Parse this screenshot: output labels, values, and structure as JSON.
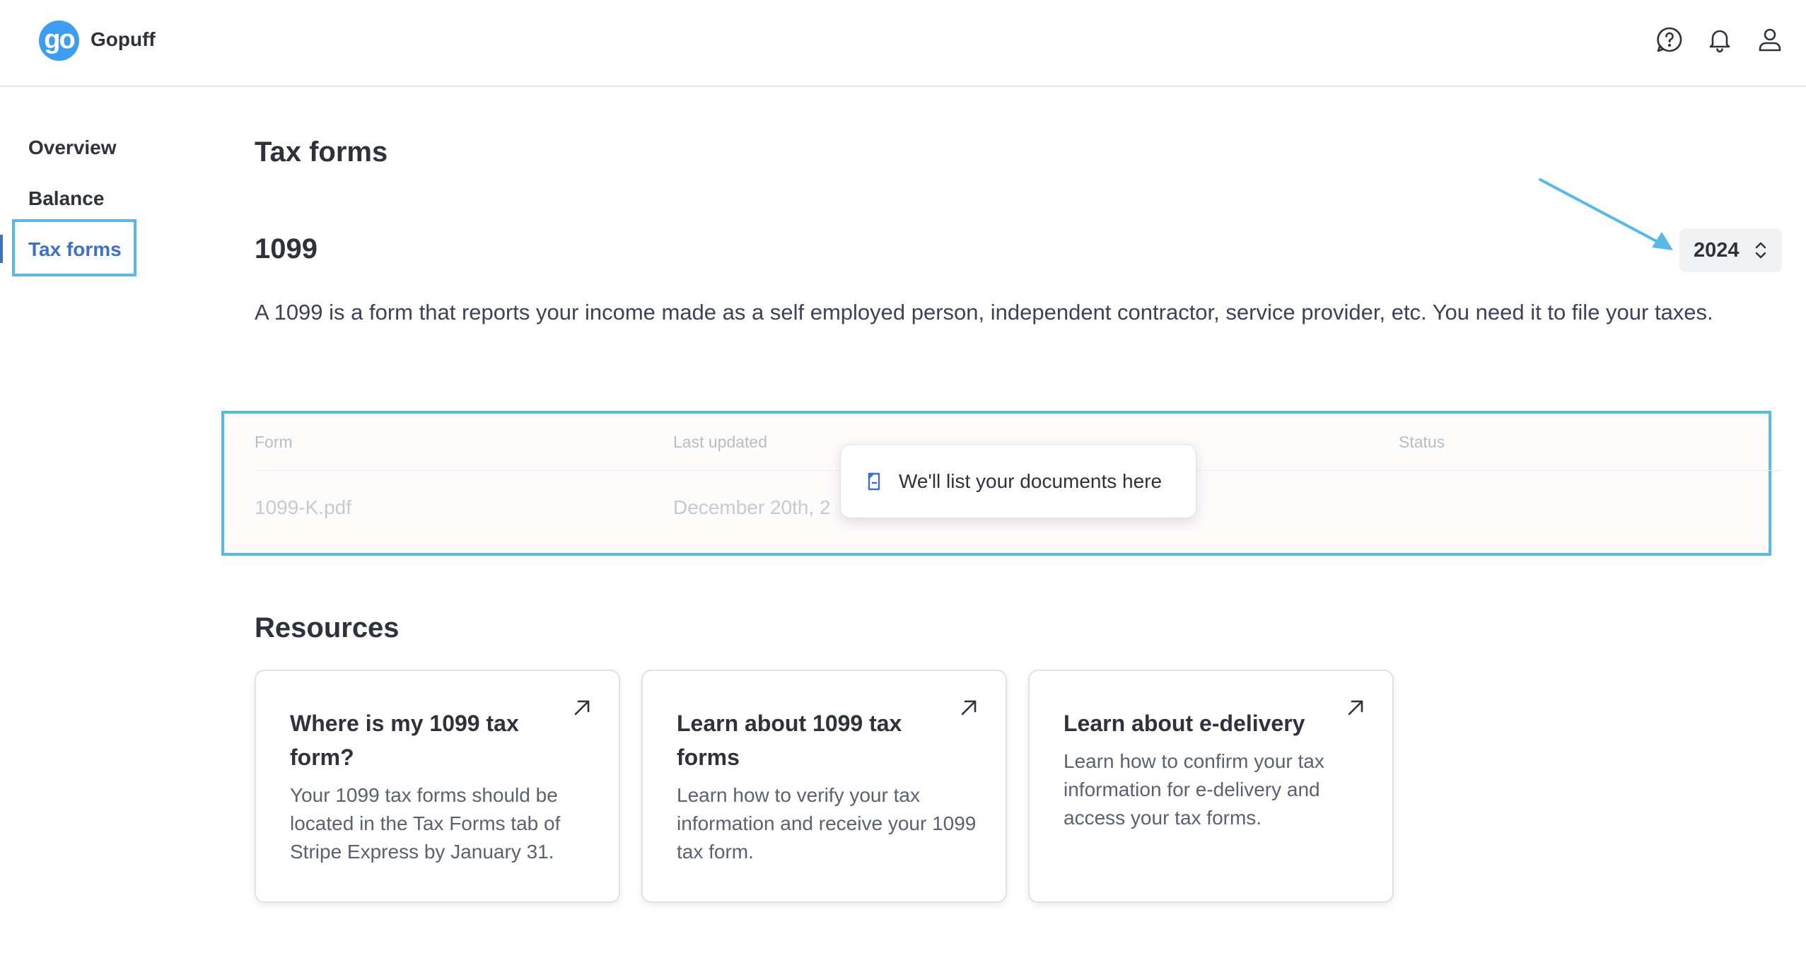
{
  "header": {
    "logo_text": "go",
    "brand_name": "Gopuff",
    "icons": [
      "help-icon",
      "bell-icon",
      "user-icon"
    ]
  },
  "sidebar": {
    "items": [
      {
        "label": "Overview"
      },
      {
        "label": "Balance"
      },
      {
        "label": "Tax forms"
      }
    ],
    "active": "Tax forms"
  },
  "main": {
    "page_title": "Tax forms",
    "section_title": "1099",
    "year_select": {
      "value": "2024"
    },
    "description": "A 1099 is a form that reports your income made as a self employed person, independent contractor, service provider, etc. You need it to file your taxes.",
    "table": {
      "columns": [
        "Form",
        "Last updated",
        "Status"
      ],
      "rows": [
        {
          "form": "1099-K.pdf",
          "last_updated": "December 20th, 2"
        }
      ]
    },
    "tooltip": {
      "icon": "document-icon",
      "text": "We'll list your documents here"
    },
    "resources": {
      "title": "Resources",
      "cards": [
        {
          "title": "Where is my 1099 tax form?",
          "body": "Your 1099 tax forms should be located in the Tax Forms tab of Stripe Express by January 31.",
          "icon": "external-link-arrow-icon"
        },
        {
          "title": "Learn about 1099 tax forms",
          "body": "Learn how to verify your tax information and receive your 1099 tax form.",
          "icon": "external-link-arrow-icon"
        },
        {
          "title": "Learn about e-delivery",
          "body": "Learn how to confirm your tax information for e-delivery and access your tax forms.",
          "icon": "external-link-arrow-icon"
        }
      ]
    }
  },
  "colors": {
    "accent_blue": "#3d70c7",
    "highlight_outline": "#58b9e8",
    "logo_blue": "#3d9df0"
  }
}
